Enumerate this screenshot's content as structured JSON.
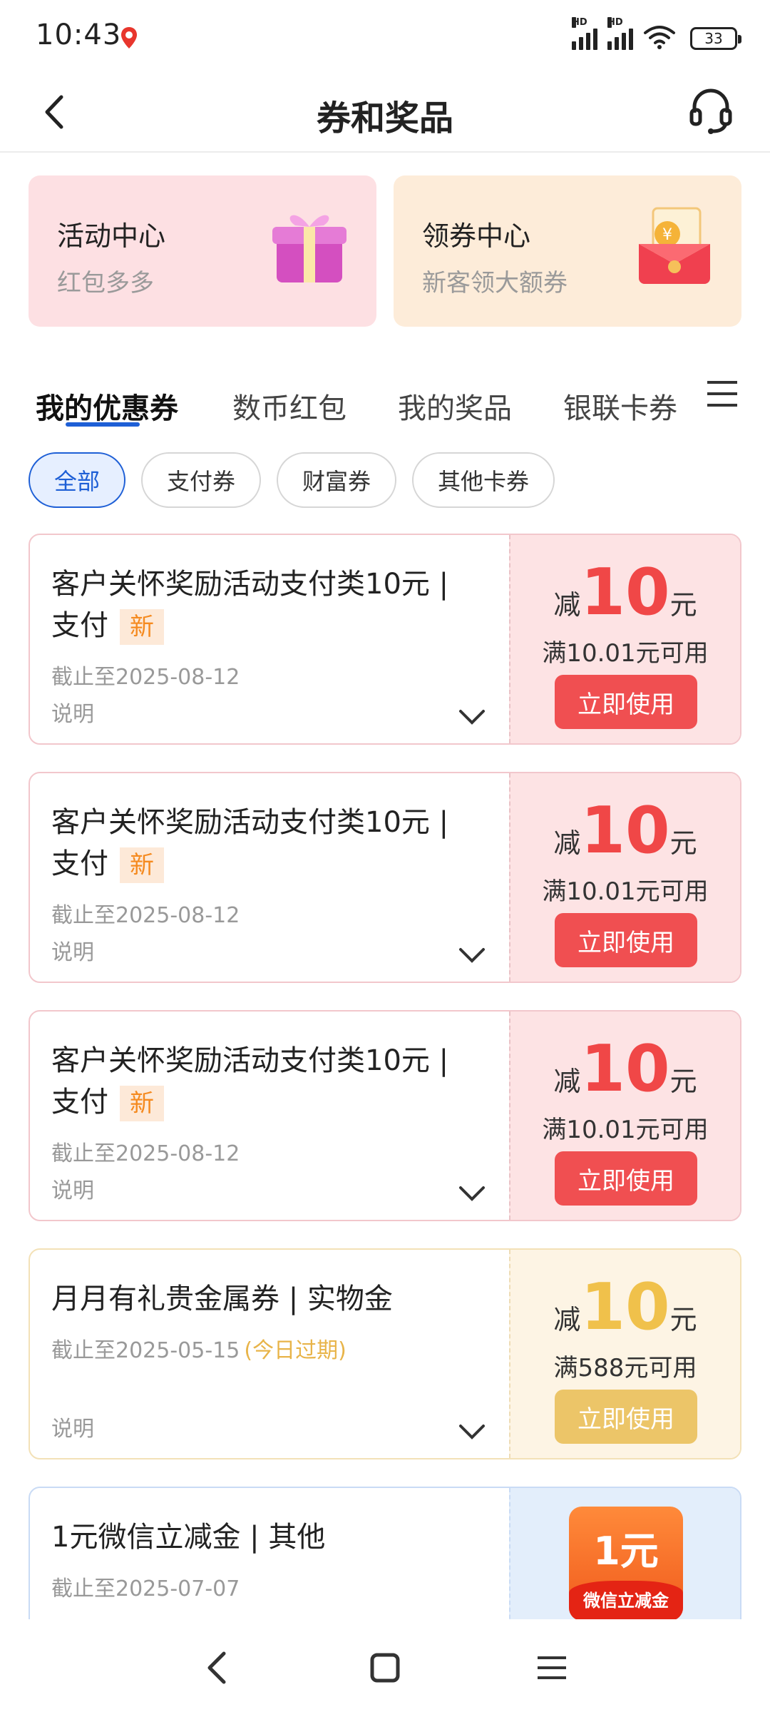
{
  "status_bar": {
    "time": "10:43",
    "signal_label": "HD",
    "battery": "33"
  },
  "header": {
    "title": "券和奖品"
  },
  "promos": [
    {
      "title": "活动中心",
      "subtitle": "红包多多",
      "icon": "gift-box-icon"
    },
    {
      "title": "领券中心",
      "subtitle": "新客领大额券",
      "icon": "red-envelope-icon"
    }
  ],
  "tabs": [
    "我的优惠券",
    "数币红包",
    "我的奖品",
    "银联卡券"
  ],
  "filters": [
    "全部",
    "支付券",
    "财富券",
    "其他卡券"
  ],
  "coupons": [
    {
      "title": "客户关怀奖励活动支付类10元 | 支付",
      "tag": "新",
      "expire": "截止至2025-08-12",
      "desc": "说明",
      "prefix": "减",
      "amount": "10",
      "unit": "元",
      "condition": "满10.01元可用",
      "button": "立即使用"
    },
    {
      "title": "客户关怀奖励活动支付类10元 | 支付",
      "tag": "新",
      "expire": "截止至2025-08-12",
      "desc": "说明",
      "prefix": "减",
      "amount": "10",
      "unit": "元",
      "condition": "满10.01元可用",
      "button": "立即使用"
    },
    {
      "title": "客户关怀奖励活动支付类10元 | 支付",
      "tag": "新",
      "expire": "截止至2025-08-12",
      "desc": "说明",
      "prefix": "减",
      "amount": "10",
      "unit": "元",
      "condition": "满10.01元可用",
      "button": "立即使用"
    },
    {
      "title": "月月有礼贵金属券 | 实物金",
      "expire": "截止至2025-05-15",
      "expire_note": "(今日过期)",
      "desc": "说明",
      "prefix": "减",
      "amount": "10",
      "unit": "元",
      "condition": "满588元可用",
      "button": "立即使用"
    },
    {
      "title": "1元微信立减金 | 其他",
      "expire": "截止至2025-07-07",
      "badge_amount": "1元",
      "badge_label": "微信立减金"
    }
  ],
  "colors": {
    "accent": "#1e5fd6",
    "coupon_red": "#f04747",
    "coupon_gold": "#f0c14b"
  }
}
